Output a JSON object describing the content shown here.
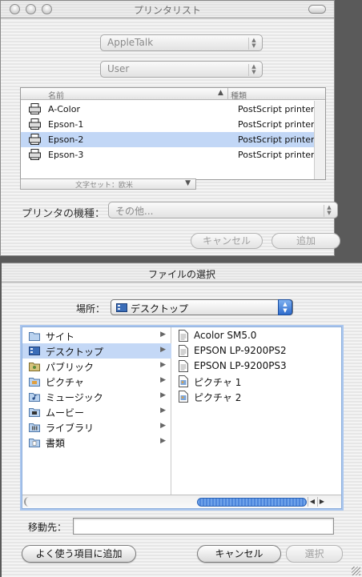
{
  "printer_window": {
    "title": "プリンタリスト",
    "connection_popup": "AppleTalk",
    "zone_popup": "User",
    "list": {
      "columns": [
        "名前",
        "種類"
      ],
      "rows": [
        {
          "name": "A-Color",
          "kind": "PostScript printer",
          "selected": false
        },
        {
          "name": "Epson-1",
          "kind": "PostScript printer",
          "selected": false
        },
        {
          "name": "Epson-2",
          "kind": "PostScript printer",
          "selected": true
        },
        {
          "name": "Epson-3",
          "kind": "PostScript printer",
          "selected": false
        }
      ],
      "charset_popup": "文字セット：欧米"
    },
    "model_label": "プリンタの機種：",
    "model_popup": "その他...",
    "cancel_label": "キャンセル",
    "add_label": "追加"
  },
  "file_sheet": {
    "title": "ファイルの選択",
    "location_label": "場所：",
    "location_value": "デスクトップ",
    "sidebar_items": [
      {
        "label": "サイト",
        "icon": "folder-icon",
        "selected": false
      },
      {
        "label": "デスクトップ",
        "icon": "desktop-icon",
        "selected": true
      },
      {
        "label": "パブリック",
        "icon": "folder-icon",
        "selected": false
      },
      {
        "label": "ピクチャ",
        "icon": "pictures-folder-icon",
        "selected": false
      },
      {
        "label": "ミュージック",
        "icon": "music-folder-icon",
        "selected": false
      },
      {
        "label": "ムービー",
        "icon": "movies-folder-icon",
        "selected": false
      },
      {
        "label": "ライブラリ",
        "icon": "library-folder-icon",
        "selected": false
      },
      {
        "label": "書類",
        "icon": "documents-folder-icon",
        "selected": false
      }
    ],
    "files": [
      {
        "label": "Acolor SM5.0",
        "icon": "document-icon"
      },
      {
        "label": "EPSON LP-9200PS2",
        "icon": "document-icon"
      },
      {
        "label": "EPSON LP-9200PS3",
        "icon": "document-icon"
      },
      {
        "label": "ピクチャ 1",
        "icon": "picture-file-icon"
      },
      {
        "label": "ピクチャ 2",
        "icon": "picture-file-icon"
      }
    ],
    "destination_label": "移動先：",
    "destination_value": "",
    "favorites_button": "よく使う項目に追加",
    "cancel_button": "キャンセル",
    "choose_button": "選択"
  },
  "colors": {
    "selection": "#c2d7f6",
    "accent": "#4d86dc"
  }
}
